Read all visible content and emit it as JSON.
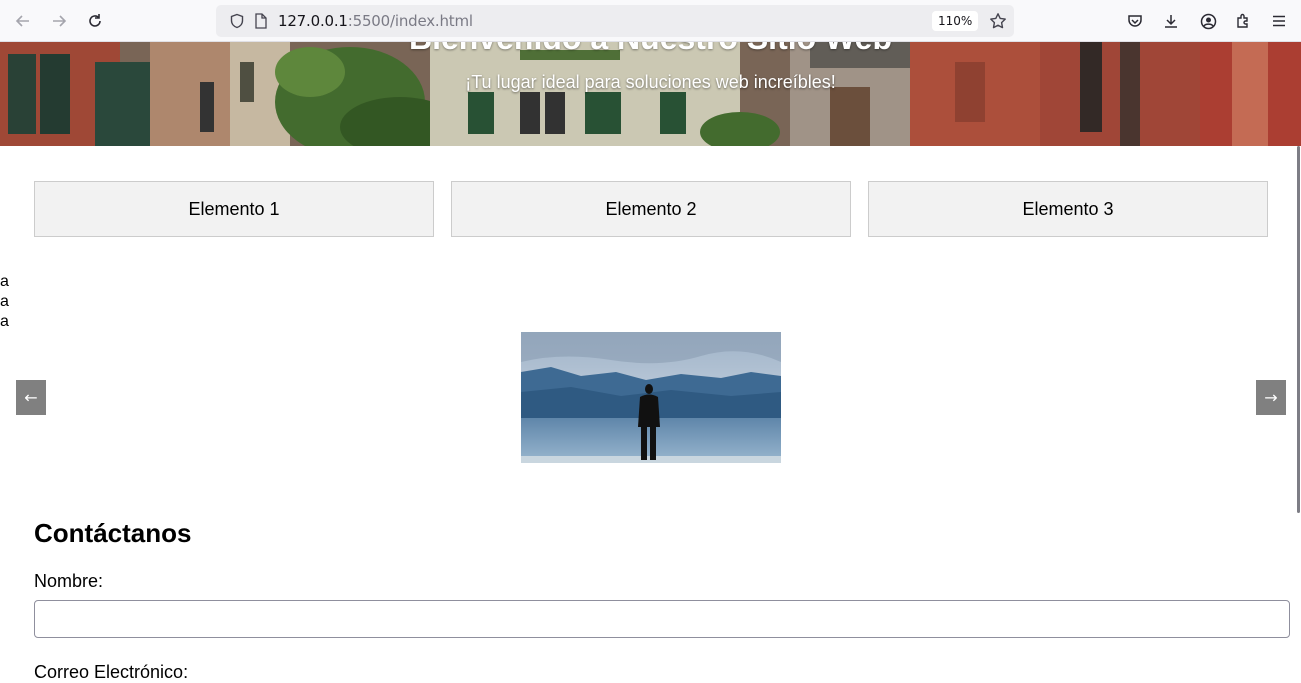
{
  "browser": {
    "url_host": "127.0.0.1",
    "url_rest": ":5500/index.html",
    "zoom": "110%",
    "icons": [
      "back-arrow-icon",
      "forward-arrow-icon",
      "reload-icon",
      "shield-icon",
      "page-icon",
      "bookmark-star-icon",
      "pocket-icon",
      "download-icon",
      "account-icon",
      "extensions-icon",
      "menu-icon"
    ]
  },
  "hero": {
    "title": "Bienvenido a Nuestro Sitio Web",
    "subtitle": "¡Tu lugar ideal para soluciones web increíbles!"
  },
  "items": [
    "Elemento 1",
    "Elemento 2",
    "Elemento 3"
  ],
  "stray_text": [
    "a",
    "a",
    "a"
  ],
  "carousel": {
    "prev_label": "←",
    "next_label": "→"
  },
  "contact": {
    "title": "Contáctanos",
    "name_label": "Nombre:",
    "name_value": "",
    "email_label": "Correo Electrónico:"
  },
  "colors": {
    "item_bg": "#f2f2f2",
    "carousel_button": "#808080"
  }
}
